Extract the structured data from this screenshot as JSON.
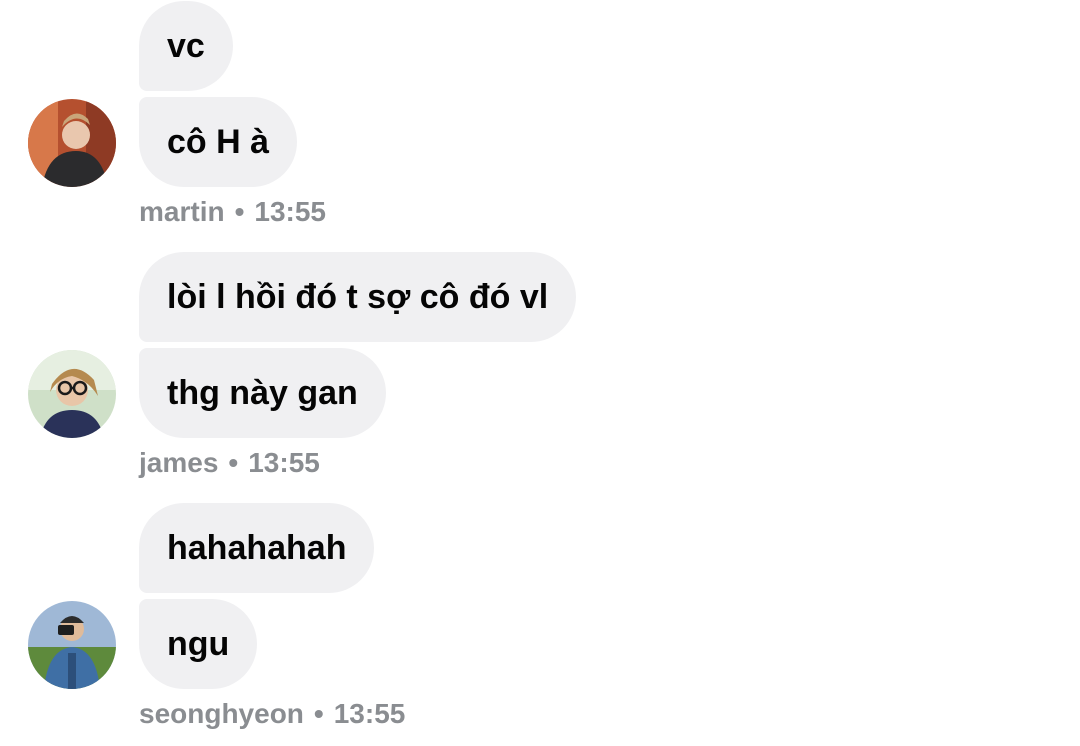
{
  "groups": [
    {
      "messages": [
        "vc",
        "cô H à"
      ],
      "sender": "martin",
      "time": "13:55",
      "avatar_icon": "user-avatar-martin"
    },
    {
      "messages": [
        "lòi l hồi đó t sợ cô đó vl",
        "thg này gan"
      ],
      "sender": "james",
      "time": "13:55",
      "avatar_icon": "user-avatar-james"
    },
    {
      "messages": [
        "hahahahah",
        "ngu"
      ],
      "sender": "seonghyeon",
      "time": "13:55",
      "avatar_icon": "user-avatar-seonghyeon"
    }
  ],
  "separator": "•",
  "colors": {
    "bubble_bg": "#f0f0f2",
    "text": "#050505",
    "meta": "#8a8d91"
  }
}
